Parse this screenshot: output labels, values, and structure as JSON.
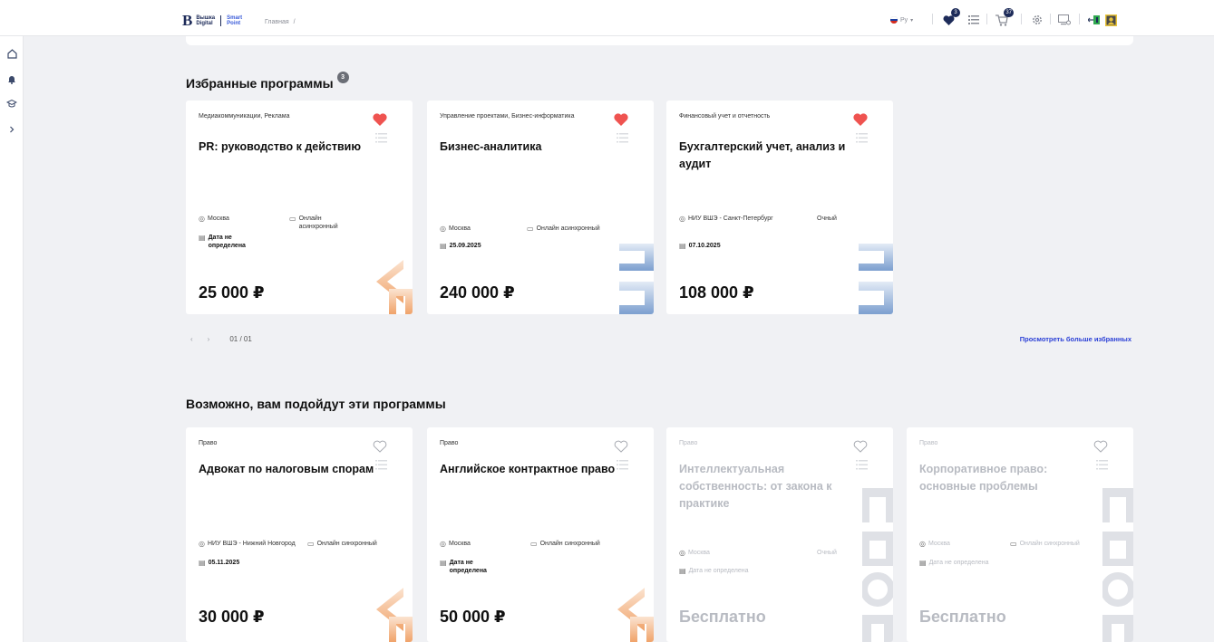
{
  "header": {
    "logo_main": "Вышка",
    "logo_sub": "Digital",
    "logo_smart": "Smart",
    "logo_point": "Point",
    "breadcrumb_home": "Главная",
    "breadcrumb_sep": "/",
    "lang": "Ру",
    "favorites_count": "3",
    "cart_count": "37"
  },
  "colors": {
    "accent_dark": "#1d2b59",
    "link": "#2a3fd6",
    "heart": "#ef5350",
    "deco_orange": "#f0a36a",
    "deco_blue": "#7c9fcf"
  },
  "favorites": {
    "title": "Избранные программы",
    "count": "3",
    "cards": [
      {
        "category": "Медиакоммуникации, Реклама",
        "title": "PR: руководство к действию",
        "location": "Москва",
        "format": "Онлайн асинхронный",
        "date": "Дата не определена",
        "price": "25 000 ₽"
      },
      {
        "category": "Управление проектами, Бизнес-информатика",
        "title": "Бизнес-аналитика",
        "location": "Москва",
        "format": "Онлайн асинхронный",
        "date": "25.09.2025",
        "price": "240 000 ₽"
      },
      {
        "category": "Финансовый учет и отчетность",
        "title": "Бухгалтерский учет, анализ и аудит",
        "location": "НИУ ВШЭ - Санкт-Петербург",
        "format": "Очный",
        "date": "07.10.2025",
        "price": "108 000 ₽"
      }
    ],
    "pager": "01 / 01",
    "more_link": "Просмотреть больше избранных"
  },
  "recommended": {
    "title": "Возможно, вам подойдут эти программы",
    "cards": [
      {
        "category": "Право",
        "title": "Адвокат по налоговым спорам",
        "location": "НИУ ВШЭ - Нижний Новгород",
        "format": "Онлайн синхронный",
        "date": "05.11.2025",
        "price": "30 000 ₽"
      },
      {
        "category": "Право",
        "title": "Английское контрактное право",
        "location": "Москва",
        "format": "Онлайн синхронный",
        "date": "Дата не определена",
        "price": "50 000 ₽"
      },
      {
        "category": "Право",
        "title": "Интеллектуальная собственность: от закона к практике",
        "location": "Москва",
        "format": "Очный",
        "date": "Дата не определена",
        "price": "Бесплатно"
      },
      {
        "category": "Право",
        "title": "Корпоративное право: основные проблемы",
        "location": "Москва",
        "format": "Онлайн синхронный",
        "date": "Дата не определена",
        "price": "Бесплатно"
      }
    ]
  }
}
